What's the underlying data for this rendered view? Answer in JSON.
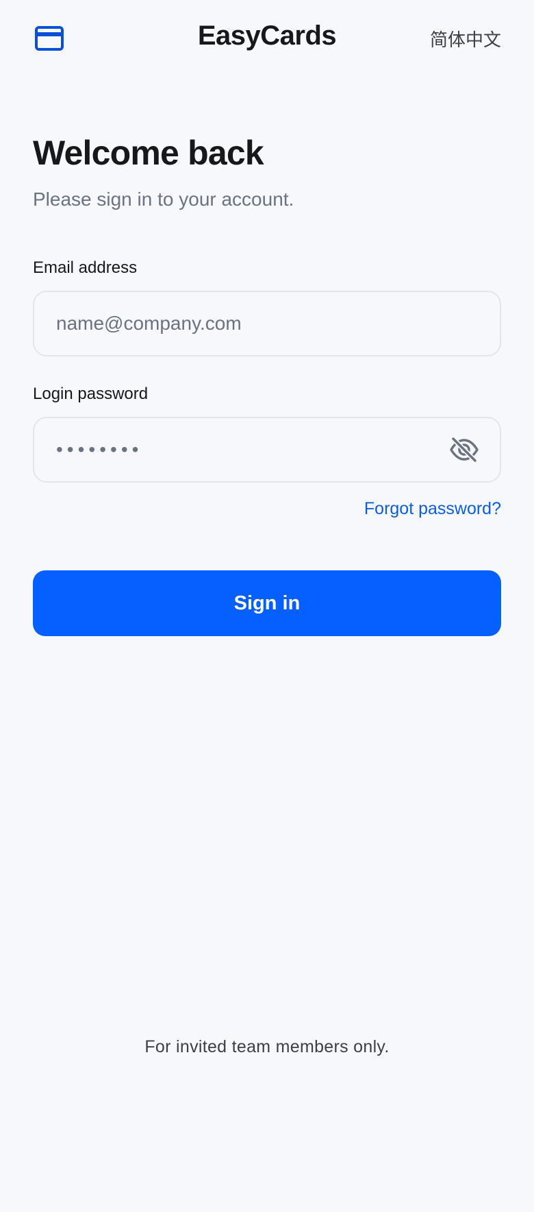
{
  "header": {
    "brand_icon": "credit-card-icon",
    "app_title": "EasyCards",
    "language_label": "简体中文"
  },
  "welcome": {
    "title": "Welcome back",
    "subtitle": "Please sign in to your account."
  },
  "form": {
    "email": {
      "label": "Email address",
      "placeholder": "name@company.com",
      "value": ""
    },
    "password": {
      "label": "Login password",
      "masked_value": "••••••••",
      "toggle_icon": "eye-off-icon"
    },
    "forgot_password_label": "Forgot password?",
    "signin_label": "Sign in"
  },
  "footer": {
    "note": "For invited team members only."
  },
  "colors": {
    "background": "#f7f8fc",
    "accent": "#0560ff",
    "link": "#0a5fe0",
    "brand_icon": "#0b4fd6",
    "muted_text": "#6b7280",
    "border": "#e3e5ea"
  }
}
